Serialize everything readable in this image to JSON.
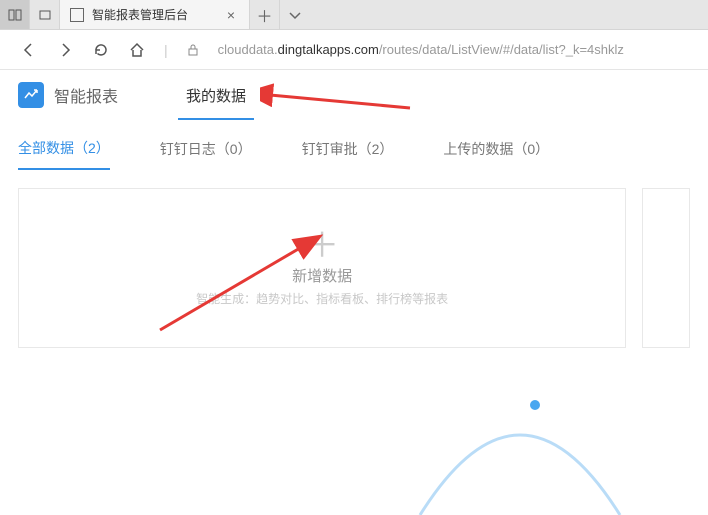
{
  "browser": {
    "tab_title": "智能报表管理后台",
    "url_prefix": "clouddata.",
    "url_host": "dingtalkapps.com",
    "url_path": "/routes/data/ListView/#/data/list?_k=4shklz"
  },
  "app": {
    "title": "智能报表",
    "nav": {
      "my_data": "我的数据"
    }
  },
  "tabs": {
    "all": "全部数据（2）",
    "dinglog": "钉钉日志（0）",
    "approval": "钉钉审批（2）",
    "uploaded": "上传的数据（0）"
  },
  "card": {
    "title": "新增数据",
    "subtitle": "智能生成：趋势对比、指标看板、排行榜等报表"
  }
}
